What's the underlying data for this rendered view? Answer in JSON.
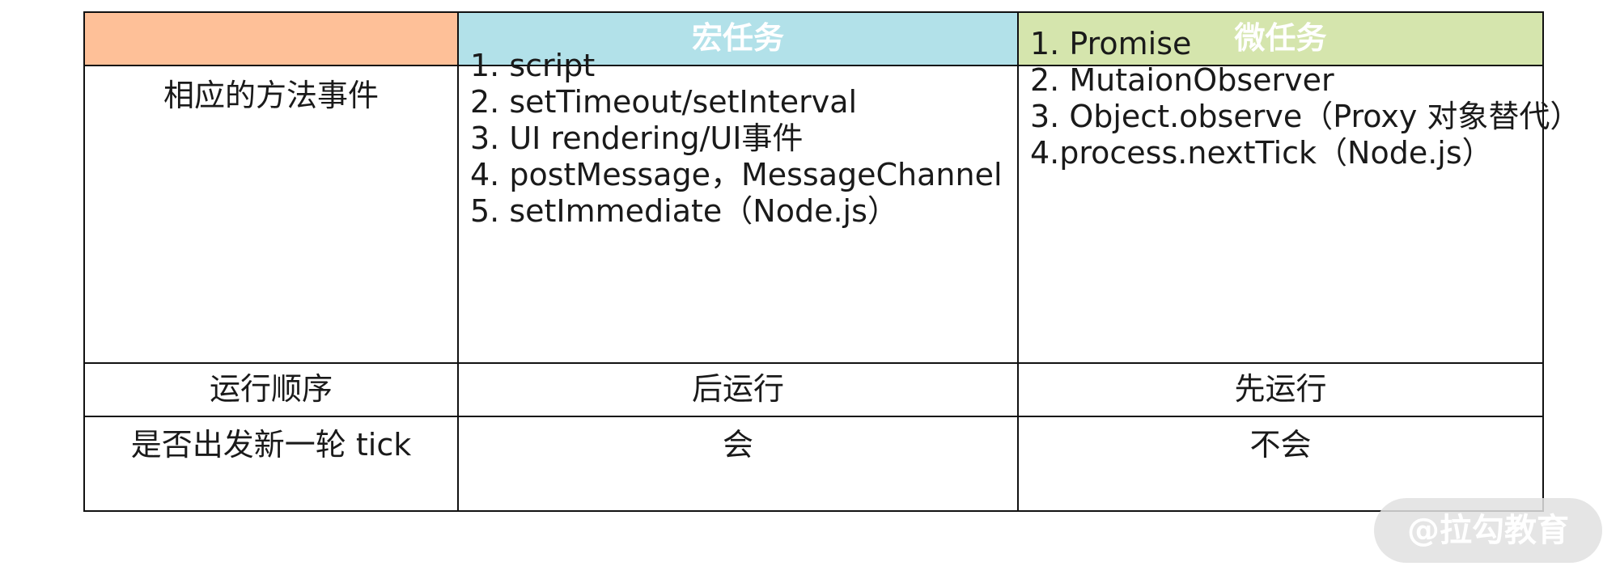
{
  "table": {
    "header": {
      "blank": "",
      "macro": "宏任务",
      "micro": "微任务"
    },
    "rows": {
      "methods": {
        "label": "相应的方法事件",
        "macro": [
          "1. script",
          "2. setTimeout/setInterval",
          "3. UI rendering/UI事件",
          "4. postMessage，MessageChannel",
          "5. setImmediate（Node.js）"
        ],
        "micro": [
          "1. Promise",
          "2. MutaionObserver",
          "3. Object.observe（Proxy 对象替代）",
          "4.process.nextTick（Node.js）"
        ]
      },
      "order": {
        "label": "运行顺序",
        "macro": "后运行",
        "micro": "先运行"
      },
      "tick": {
        "label": "是否出发新一轮 tick",
        "macro": "会",
        "micro": "不会"
      }
    },
    "colors": {
      "header_blank_bg": "#fec098",
      "header_macro_bg": "#b2e1e9",
      "header_micro_bg": "#d5e5ad"
    }
  },
  "watermark": "@拉勾教育"
}
